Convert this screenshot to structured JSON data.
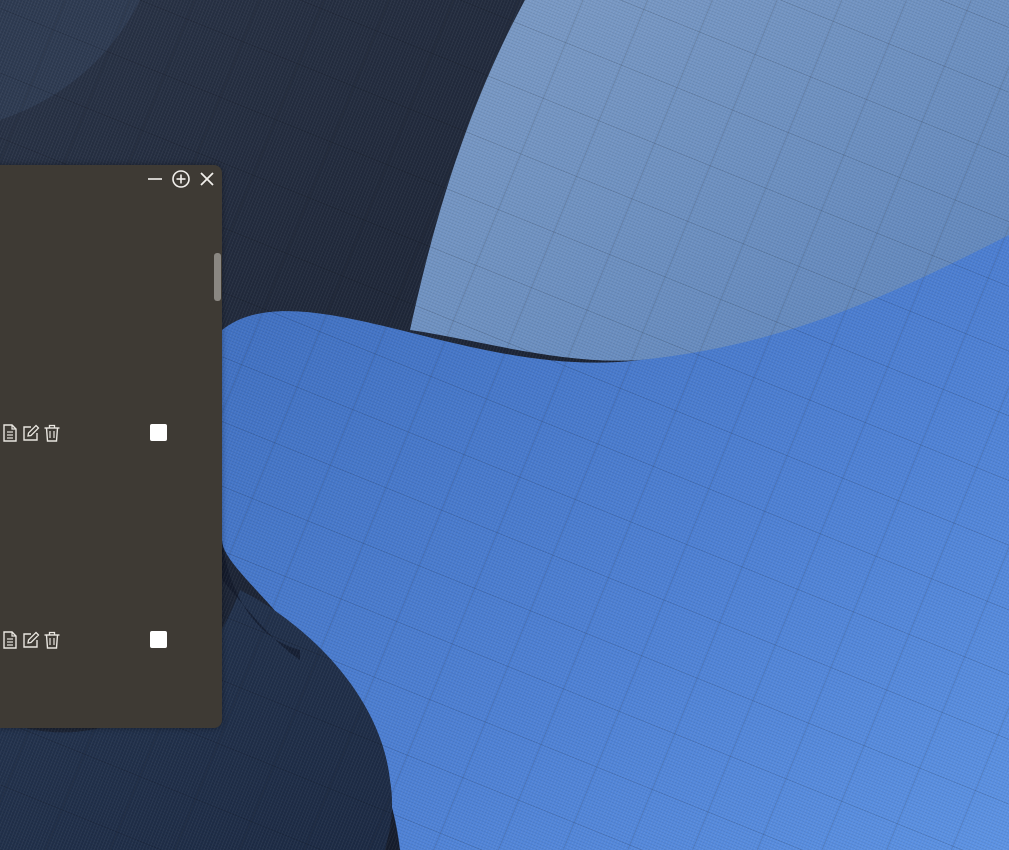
{
  "desktop": {
    "wallpaper_colors": {
      "dark_navy": "#1b2638",
      "steel_blue": "#6a8fc0",
      "bright_blue": "#4f82d6",
      "shadow_blue": "#2a3a55"
    }
  },
  "window": {
    "background": "#3e3a34",
    "controls": [
      {
        "name": "minimize-icon",
        "icon": "minus"
      },
      {
        "name": "maximize-icon",
        "icon": "circle-plus"
      },
      {
        "name": "close-icon",
        "icon": "x"
      }
    ],
    "rows": [
      {
        "actions": [
          {
            "name": "view-document-icon",
            "icon": "document"
          },
          {
            "name": "edit-icon",
            "icon": "pencil-square"
          },
          {
            "name": "delete-icon",
            "icon": "trash"
          }
        ],
        "checked": false
      },
      {
        "actions": [
          {
            "name": "view-document-icon",
            "icon": "document"
          },
          {
            "name": "edit-icon",
            "icon": "pencil-square"
          },
          {
            "name": "delete-icon",
            "icon": "trash"
          }
        ],
        "checked": false
      }
    ]
  }
}
